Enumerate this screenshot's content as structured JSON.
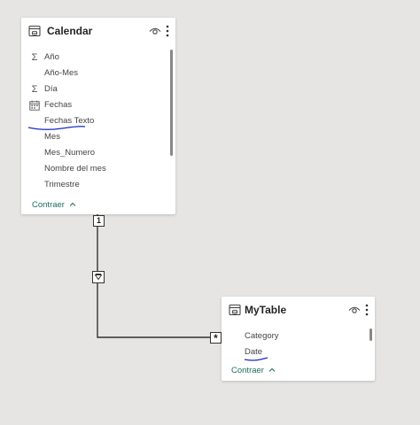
{
  "calendar": {
    "title": "Calendar",
    "fields": [
      {
        "label": "Año",
        "icon": "sigma-icon"
      },
      {
        "label": "Año-Mes",
        "icon": ""
      },
      {
        "label": "Día",
        "icon": "sigma-icon"
      },
      {
        "label": "Fechas",
        "icon": "calendar-icon"
      },
      {
        "label": "Fechas Texto",
        "icon": ""
      },
      {
        "label": "Mes",
        "icon": ""
      },
      {
        "label": "Mes_Numero",
        "icon": ""
      },
      {
        "label": "Nombre del mes",
        "icon": ""
      },
      {
        "label": "Trimestre",
        "icon": ""
      }
    ],
    "collapse_label": "Contraer"
  },
  "mytable": {
    "title": "MyTable",
    "fields": [
      {
        "label": "Category",
        "icon": ""
      },
      {
        "label": "Date",
        "icon": ""
      }
    ],
    "collapse_label": "Contraer"
  },
  "relationship": {
    "one_side_label": "1",
    "many_side_label": "*"
  },
  "colors": {
    "canvas": "#e6e5e4",
    "link": "#1f6e5c",
    "ink_underline": "#1a2bbf"
  }
}
